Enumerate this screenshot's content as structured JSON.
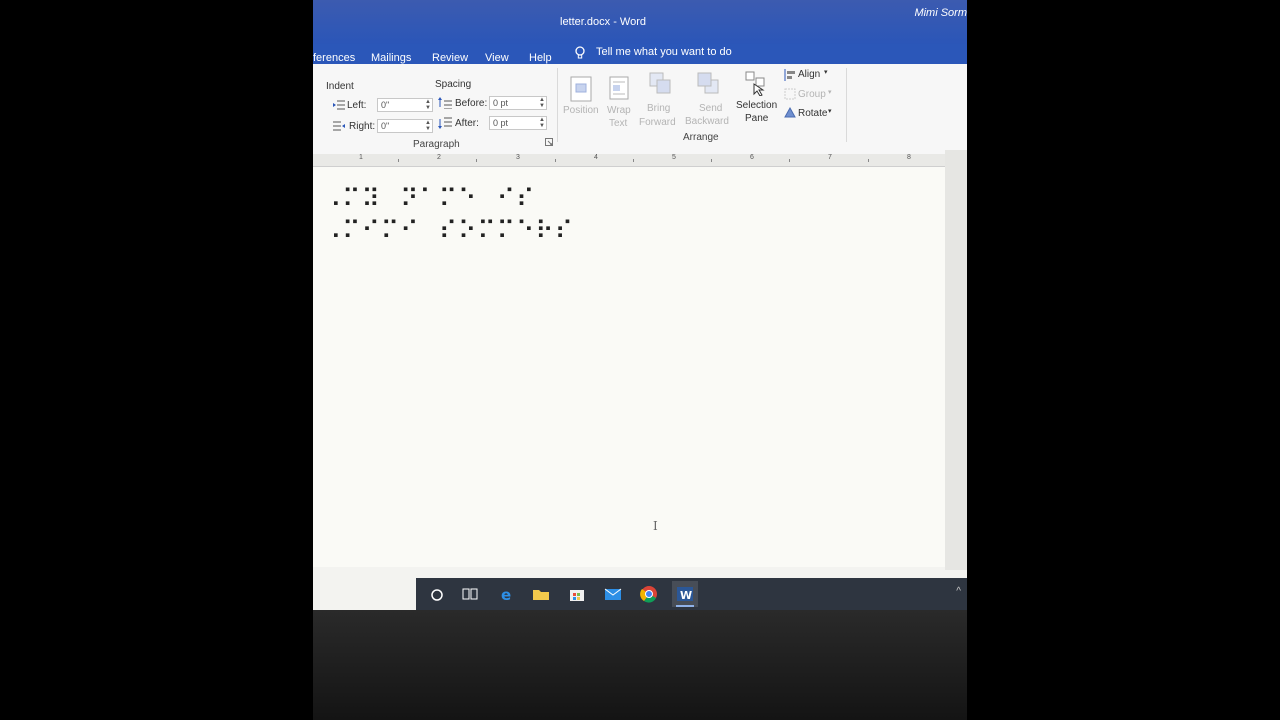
{
  "window": {
    "title": "letter.docx  -  Word",
    "user": "Mimi Sorm"
  },
  "tabs": [
    "ferences",
    "Mailings",
    "Review",
    "View",
    "Help"
  ],
  "tell_me": "Tell me what you want to do",
  "paragraph_group": {
    "indent_label": "Indent",
    "spacing_label": "Spacing",
    "left_label": "Left:",
    "left_value": "0\"",
    "right_label": "Right:",
    "right_value": "0\"",
    "before_label": "Before:",
    "before_value": "0 pt",
    "after_label": "After:",
    "after_value": "0 pt",
    "group_label": "Paragraph"
  },
  "arrange_group": {
    "position": "Position",
    "wrap": [
      "Wrap",
      "Text"
    ],
    "bring": [
      "Bring",
      "Forward"
    ],
    "send": [
      "Send",
      "Backward"
    ],
    "selection": [
      "Selection",
      "Pane"
    ],
    "align": "Align",
    "group": "Group",
    "rotate": "Rotate",
    "group_label": "Arrange"
  },
  "ruler_numbers": [
    "1",
    "2",
    "3",
    "4",
    "5",
    "6",
    "7",
    "8"
  ],
  "document": {
    "braille_line_1": "⠠⠍⠽⠀⠝⠁⠍⠑⠀⠊⠎",
    "braille_line_2": "⠠⠍⠊⠍⠊⠀⠎⠕⠍⠍⠑⠗⠎"
  },
  "colors": {
    "title_bar": "#2b57b9",
    "word_icon": "#2b5797",
    "taskbar": "#2e3540"
  },
  "taskbar_icons": [
    "cortana-icon",
    "task-view-icon",
    "edge-icon",
    "file-explorer-icon",
    "store-icon",
    "mail-icon",
    "chrome-icon",
    "word-icon"
  ]
}
